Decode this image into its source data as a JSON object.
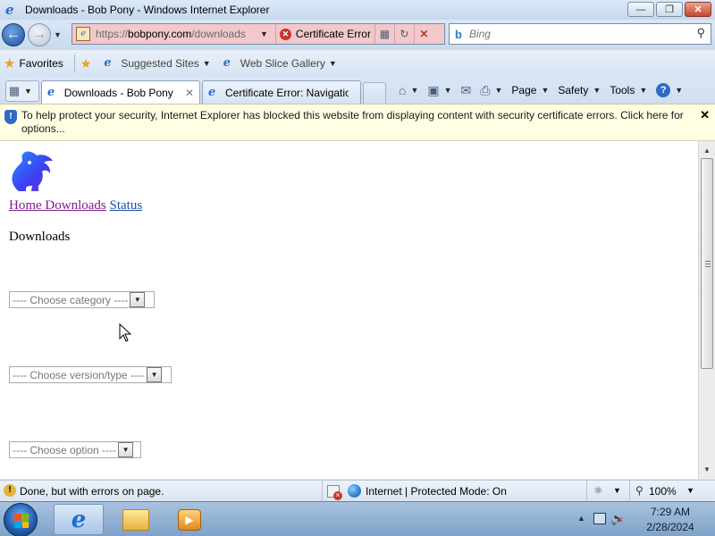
{
  "window": {
    "title": "Downloads - Bob Pony - Windows Internet Explorer",
    "minimize_glyph": "—",
    "restore_glyph": "❐",
    "close_glyph": "✕"
  },
  "address_bar": {
    "url_scheme": "https://",
    "url_host": "bobpony.com",
    "url_path": "/downloads",
    "certificate_error_label": "Certificate Error",
    "address_bg": "#f2c8cb"
  },
  "search": {
    "placeholder": "Bing"
  },
  "favorites_bar": {
    "favorites_label": "Favorites",
    "suggested_sites_label": "Suggested Sites",
    "web_slice_gallery_label": "Web Slice Gallery"
  },
  "tabs": [
    {
      "label": "Downloads - Bob Pony",
      "active": true
    },
    {
      "label": "Certificate Error: Navigatio...",
      "active": false
    }
  ],
  "command_bar": {
    "page_label": "Page",
    "safety_label": "Safety",
    "tools_label": "Tools"
  },
  "info_bar": {
    "message": "To help protect your security, Internet Explorer has blocked this website from displaying content with security certificate errors. Click here for options..."
  },
  "page": {
    "nav_links": {
      "home": "Home",
      "downloads": "Downloads",
      "status": "Status"
    },
    "heading": "Downloads",
    "category_select": "---- Choose category ----",
    "version_select": "---- Choose version/type ----",
    "option_select": "---- Choose option ----"
  },
  "status_bar": {
    "status_text": "Done, but with errors on page.",
    "zone_text": "Internet | Protected Mode: On",
    "zoom": "100%"
  },
  "taskbar": {
    "time": "7:29 AM",
    "date": "2/28/2024"
  },
  "colors": {
    "link_visited": "#7a1f8a",
    "link": "#1b4fa8",
    "info_bar_bg": "#fffee2"
  }
}
